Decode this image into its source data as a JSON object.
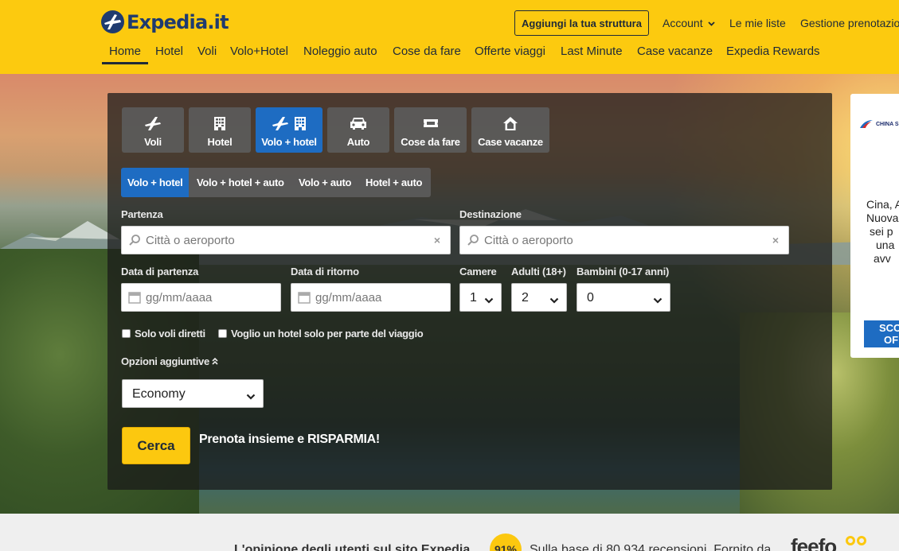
{
  "header": {
    "logo_text": "Expedia.it",
    "add_property": "Aggiungi la tua struttura",
    "account": "Account",
    "my_lists": "Le mie liste",
    "manage_bookings": "Gestione prenotazion",
    "nav": [
      {
        "label": "Home"
      },
      {
        "label": "Hotel"
      },
      {
        "label": "Voli"
      },
      {
        "label": "Volo+Hotel"
      },
      {
        "label": "Noleggio auto"
      },
      {
        "label": "Cose da fare"
      },
      {
        "label": "Offerte viaggi"
      },
      {
        "label": "Last Minute"
      },
      {
        "label": "Case vacanze"
      },
      {
        "label": "Expedia Rewards"
      }
    ]
  },
  "search": {
    "lob_tabs": [
      {
        "label": "Voli",
        "icon": "plane-icon"
      },
      {
        "label": "Hotel",
        "icon": "building-icon"
      },
      {
        "label": "Volo + hotel",
        "icon": "plane-building-icon",
        "active": true
      },
      {
        "label": "Auto",
        "icon": "car-icon"
      },
      {
        "label": "Cose da fare",
        "icon": "ticket-icon"
      },
      {
        "label": "Case vacanze",
        "icon": "house-icon"
      }
    ],
    "sub_tabs": [
      {
        "label": "Volo + hotel",
        "active": true
      },
      {
        "label": "Volo + hotel + auto"
      },
      {
        "label": "Volo + auto"
      },
      {
        "label": "Hotel + auto"
      }
    ],
    "origin": {
      "label": "Partenza",
      "placeholder": "Città o aeroporto",
      "value": ""
    },
    "destination": {
      "label": "Destinazione",
      "placeholder": "Città o aeroporto",
      "value": ""
    },
    "depart_date": {
      "label": "Data di partenza",
      "placeholder": "gg/mm/aaaa",
      "value": ""
    },
    "return_date": {
      "label": "Data di ritorno",
      "placeholder": "gg/mm/aaaa",
      "value": ""
    },
    "rooms": {
      "label": "Camere",
      "value": "1"
    },
    "adults": {
      "label": "Adulti (18+)",
      "value": "2"
    },
    "children": {
      "label": "Bambini (0-17 anni)",
      "value": "0"
    },
    "direct_flights": {
      "label": "Solo voli diretti",
      "checked": false
    },
    "partial_hotel": {
      "label": "Voglio un hotel solo per parte del viaggio",
      "checked": false
    },
    "more_options": {
      "label": "Opzioni aggiuntive"
    },
    "cabin_class": {
      "value": "Economy"
    },
    "submit": "Cerca",
    "promo": "Prenota insieme e RISPARMIA!"
  },
  "ad": {
    "brand": "CHINA S",
    "lines": [
      "Cina, A",
      "Nuova",
      "sei p",
      "una",
      "avv"
    ],
    "cta_lines": [
      "SCO",
      "OF"
    ]
  },
  "reviews": {
    "lead": "L'opinione degli utenti sul sito Expedia",
    "score": "91%",
    "based_on": "Sulla base di 80.934 recensioni. Fornito da",
    "provider": "feefo"
  },
  "colors": {
    "brand_yellow": "#fcca0f",
    "brand_navy": "#1f3b6f",
    "active_blue": "#1e6cc2"
  }
}
